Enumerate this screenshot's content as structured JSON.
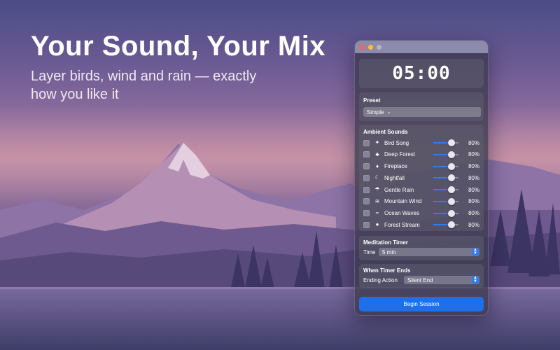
{
  "hero": {
    "title": "Your Sound, Your Mix",
    "subtitle": "Layer birds, wind and rain — exactly how you like it"
  },
  "window": {
    "timer": "05:00",
    "preset": {
      "label": "Preset",
      "value": "Simple"
    },
    "ambient": {
      "label": "Ambient Sounds",
      "sounds": [
        {
          "name": "Bird Song",
          "icon": "bird-icon",
          "level": 80,
          "level_text": "80%",
          "checked": false
        },
        {
          "name": "Deep Forest",
          "icon": "tree-icon",
          "level": 80,
          "level_text": "80%",
          "checked": false
        },
        {
          "name": "Fireplace",
          "icon": "flame-icon",
          "level": 80,
          "level_text": "80%",
          "checked": false
        },
        {
          "name": "Nightfall",
          "icon": "moon-icon",
          "level": 80,
          "level_text": "80%",
          "checked": false
        },
        {
          "name": "Gentle Rain",
          "icon": "rain-icon",
          "level": 80,
          "level_text": "80%",
          "checked": false
        },
        {
          "name": "Mountain Wind",
          "icon": "wind-icon",
          "level": 80,
          "level_text": "80%",
          "checked": false
        },
        {
          "name": "Ocean Waves",
          "icon": "waves-icon",
          "level": 80,
          "level_text": "80%",
          "checked": false
        },
        {
          "name": "Forest Stream",
          "icon": "drop-icon",
          "level": 80,
          "level_text": "80%",
          "checked": false
        }
      ]
    },
    "meditation": {
      "label": "Meditation Timer",
      "time_label": "Time",
      "time_value": "5 min"
    },
    "ending": {
      "label": "When Timer Ends",
      "action_label": "Ending Action",
      "action_value": "Silent End"
    },
    "begin_label": "Begin Session"
  },
  "colors": {
    "accent": "#2f7bf2",
    "button": "#1f6fe6",
    "close": "#ff5f57",
    "minimize": "#febc2e"
  }
}
